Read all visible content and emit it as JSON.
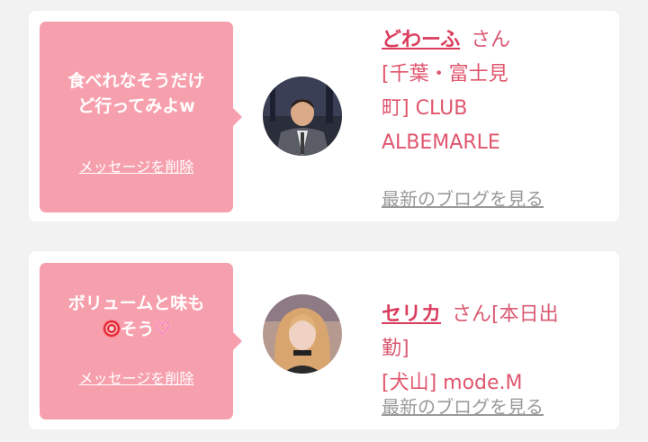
{
  "posts": [
    {
      "message": "食べれなそうだけ\nど行ってみよw",
      "delete_label": "メッセージを削除",
      "name": "どわーふ",
      "honorific": "さん",
      "shop": "[千葉・富士見\n町] CLUB\nALBEMARLE",
      "blog_label": "最新のブログを見る"
    },
    {
      "message_line1": "ボリュームと味も",
      "message_line2": "そう",
      "delete_label": "メッセージを削除",
      "name": "セリカ",
      "honorific": "さん[本日出\n勤]",
      "shop": "[犬山] mode.M",
      "blog_label": "最新のブログを見る"
    }
  ],
  "colors": {
    "bubble": "#f7a0ad",
    "accent": "#e0566e",
    "link_gray": "#9a9a9a"
  },
  "icons": [
    "flower-emoji-icon",
    "heart-emoji-icon"
  ]
}
